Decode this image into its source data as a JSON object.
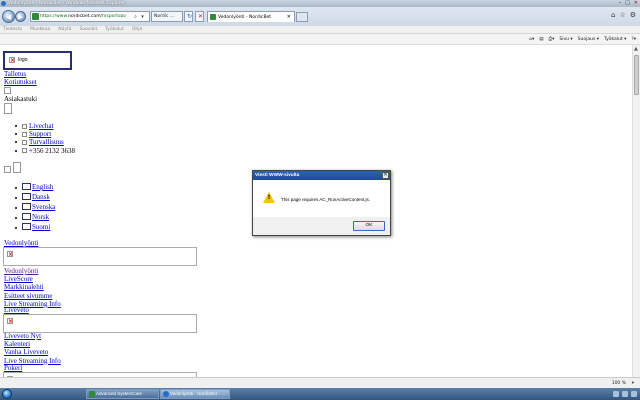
{
  "window": {
    "title": "Vedonlyönti - NordicBet - Windows Internet Explorer"
  },
  "addressbar": {
    "url_prefix": "https://www.",
    "url_host": "nordicbet.com",
    "url_path": "/fi/sportsbo",
    "search_label": "Nordic ..."
  },
  "tabs": [
    {
      "label": "Vedonlyönti - NordicBet"
    }
  ],
  "menubar": [
    "Tiedosto",
    "Muokkaa",
    "Näytä",
    "Suosikit",
    "Työkalut",
    "Ohje"
  ],
  "commandbar": [
    "Sivu ▾",
    "Suojaus ▾",
    "Työkalut ▾"
  ],
  "page": {
    "logo_alt": "logo",
    "top_links": [
      "Talletus",
      "Kotiutukset"
    ],
    "asiakastuki": "Asiakastuki",
    "support_items": [
      "Livechat",
      "Support",
      "Turvallisuus",
      "+356 2132 3638"
    ],
    "languages": [
      "English",
      "Dansk",
      "Svenska",
      "Norsk",
      "Suomi"
    ],
    "vedonlyonti_header": "Vedonlyönti",
    "vedonlyonti_links": [
      "Vedonlyönti",
      "LiveScore",
      "Markkinalehti",
      "Esitteet sivumme",
      "Live Streaming Info"
    ],
    "liveveto_header": "Liveveto",
    "liveveto_links": [
      "Liveveto Nyt",
      "Kalenteri",
      "Vanha Liveveto",
      "Live Streaming Info"
    ],
    "pokeri_header": "Pokeri"
  },
  "dialog": {
    "title": "Viesti WWW-sivulta",
    "message": "This page requires AC_RunActiveContent.js.",
    "ok_label": "OK"
  },
  "statusbar": {
    "zoom": "100 %"
  },
  "taskbar": {
    "items": [
      "Advanced SystemCare",
      "Vedonlyönti - NordicBet - ..."
    ]
  },
  "colors": {
    "titlebar": "#aab8c8",
    "link": "#0000cc",
    "visited_link": "#551a8b",
    "dialog_title": "#1e4c97",
    "warning": "#f2c500"
  }
}
